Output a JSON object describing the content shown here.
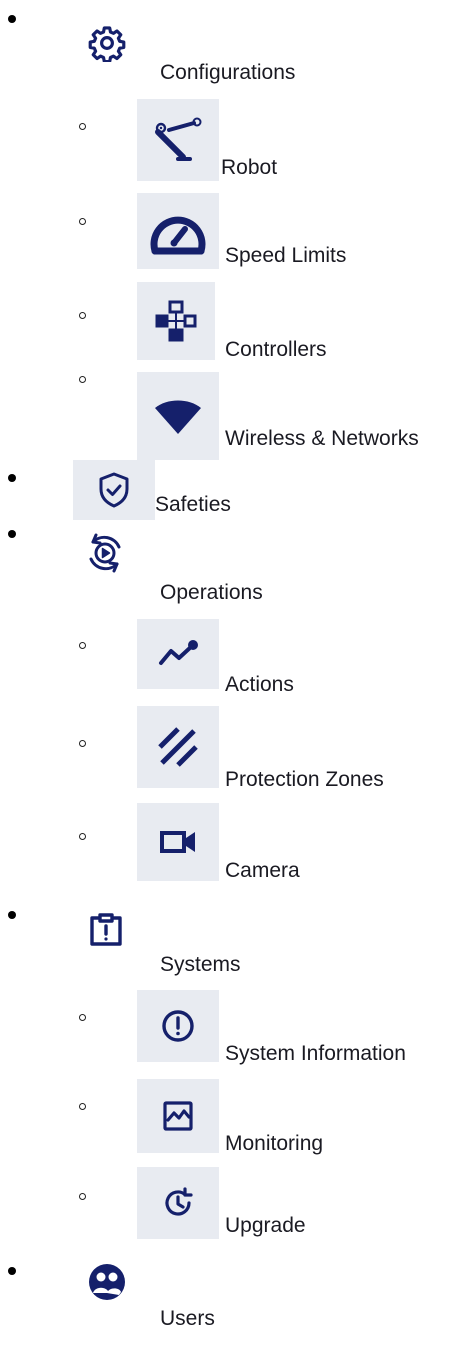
{
  "nav": {
    "configurations": {
      "label": "Configurations",
      "icon": "gear-icon",
      "children": {
        "robot": {
          "label": "Robot",
          "icon": "robot-arm-icon"
        },
        "speed_limits": {
          "label": "Speed Limits",
          "icon": "speedometer-icon"
        },
        "controllers": {
          "label": "Controllers",
          "icon": "controller-icon"
        },
        "wireless": {
          "label": "Wireless & Networks",
          "icon": "wifi-icon"
        }
      }
    },
    "safeties": {
      "label": "Safeties",
      "icon": "shield-check-icon"
    },
    "operations": {
      "label": "Operations",
      "icon": "operations-icon",
      "children": {
        "actions": {
          "label": "Actions",
          "icon": "trend-line-icon"
        },
        "protection_zones": {
          "label": "Protection Zones",
          "icon": "hatched-zone-icon"
        },
        "camera": {
          "label": "Camera",
          "icon": "video-camera-icon"
        }
      }
    },
    "systems": {
      "label": "Systems",
      "icon": "clipboard-alert-icon",
      "children": {
        "system_information": {
          "label": "System Information",
          "icon": "alert-circle-icon"
        },
        "monitoring": {
          "label": "Monitoring",
          "icon": "monitoring-chart-icon"
        },
        "upgrade": {
          "label": "Upgrade",
          "icon": "clock-arrow-icon"
        }
      }
    },
    "users": {
      "label": "Users",
      "icon": "users-icon"
    }
  },
  "colors": {
    "icon": "#15206b",
    "icon_box_bg": "#e8ebf1",
    "text": "#1a1a22"
  }
}
